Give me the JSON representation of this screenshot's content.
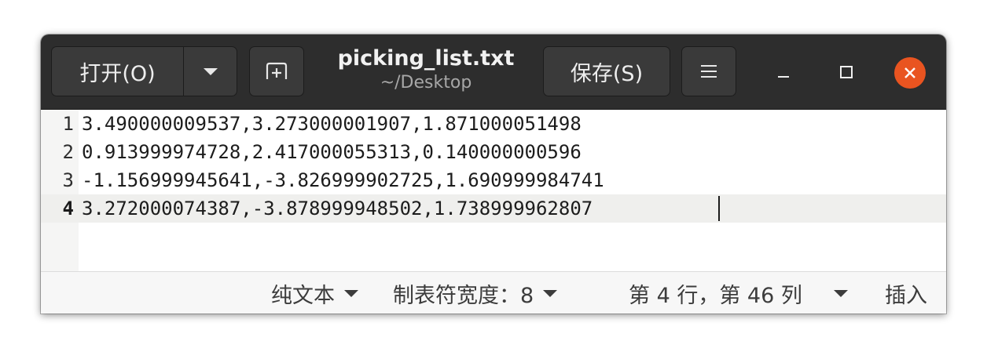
{
  "header": {
    "open_label": "打开(O)",
    "title": "picking_list.txt",
    "subtitle": "~/Desktop",
    "save_label": "保存(S)"
  },
  "icons": {
    "open_menu": "chevron-down-icon",
    "new_tab": "new-tab-icon",
    "hamburger": "hamburger-menu-icon",
    "minimize": "minimize-icon",
    "maximize": "maximize-icon",
    "close": "close-icon"
  },
  "colors": {
    "headerbar": "#2d2d2d",
    "close_button": "#e95420",
    "current_line": "#efefed"
  },
  "editor": {
    "lines": [
      {
        "number": "1",
        "text": "3.490000009537,3.273000001907,1.871000051498"
      },
      {
        "number": "2",
        "text": "0.913999974728,2.417000055313,0.140000000596"
      },
      {
        "number": "3",
        "text": "-1.156999945641,-3.826999902725,1.690999984741"
      },
      {
        "number": "4",
        "text": "3.272000074387,-3.878999948502,1.738999962807"
      }
    ],
    "current_line": 4
  },
  "statusbar": {
    "language": "纯文本",
    "tab_width": "制表符宽度：8",
    "cursor_position": "第 4 行，第 46 列",
    "insert_mode": "插入"
  }
}
